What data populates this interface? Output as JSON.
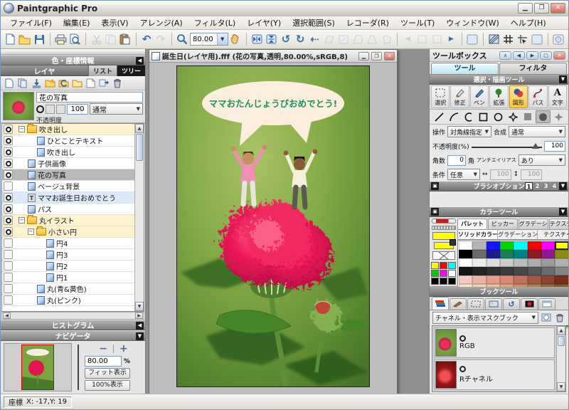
{
  "window": {
    "title": "Paintgraphic Pro"
  },
  "menu": {
    "items": [
      "ファイル(F)",
      "編集(E)",
      "表示(V)",
      "アレンジ(A)",
      "フィルタ(L)",
      "レイヤ(Y)",
      "選択範囲(S)",
      "レコーダ(R)",
      "ツール(T)",
      "ウィンドウ(W)",
      "ヘルプ(H)"
    ]
  },
  "toolbar": {
    "zoom_value": "80.00"
  },
  "left_panel": {
    "color_info_header": "色・座標情報",
    "layers": {
      "header": "レイヤ",
      "tab_list": "リスト",
      "tab_tree": "ツリー",
      "active_name": "花の写真",
      "opacity_value": "100",
      "blend_mode": "通常",
      "opacity_label": "不透明度(%)",
      "items": [
        {
          "label": "吹き出し",
          "type": "folder",
          "indent": 0,
          "visible": true,
          "selected": false,
          "hl": false
        },
        {
          "label": "ひとことテキスト",
          "type": "layer",
          "indent": 2,
          "visible": true,
          "selected": false,
          "hl": false
        },
        {
          "label": "吹き出し",
          "type": "layer",
          "indent": 2,
          "visible": true,
          "selected": false,
          "hl": false
        },
        {
          "label": "子供画像",
          "type": "layer",
          "indent": 1,
          "visible": true,
          "selected": false,
          "hl": false
        },
        {
          "label": "花の写真",
          "type": "layer",
          "indent": 1,
          "visible": true,
          "selected": true,
          "hl": false
        },
        {
          "label": "ベージュ背景",
          "type": "layer",
          "indent": 1,
          "visible": false,
          "selected": false,
          "hl": false
        },
        {
          "label": "ママお誕生日おめでとう",
          "type": "text",
          "indent": 1,
          "visible": true,
          "selected": false,
          "hl": true
        },
        {
          "label": "パス",
          "type": "layer",
          "indent": 1,
          "visible": true,
          "selected": false,
          "hl": false
        },
        {
          "label": "丸イラスト",
          "type": "folder",
          "indent": 0,
          "visible": true,
          "selected": false,
          "hl": false
        },
        {
          "label": "小さい円",
          "type": "folder",
          "indent": 1,
          "visible": true,
          "selected": false,
          "hl": false
        },
        {
          "label": "円4",
          "type": "layer",
          "indent": 3,
          "visible": false,
          "selected": false,
          "hl": false
        },
        {
          "label": "円3",
          "type": "layer",
          "indent": 3,
          "visible": false,
          "selected": false,
          "hl": false
        },
        {
          "label": "円2",
          "type": "layer",
          "indent": 3,
          "visible": false,
          "selected": false,
          "hl": false
        },
        {
          "label": "円1",
          "type": "layer",
          "indent": 3,
          "visible": false,
          "selected": false,
          "hl": false
        },
        {
          "label": "丸(青&黄色)",
          "type": "layer",
          "indent": 2,
          "visible": false,
          "selected": false,
          "hl": false
        },
        {
          "label": "丸(ピンク)",
          "type": "layer",
          "indent": 2,
          "visible": false,
          "selected": false,
          "hl": false
        }
      ]
    },
    "histogram_header": "ヒストグラム",
    "navigator": {
      "header": "ナビゲータ",
      "minus": "−",
      "plus": "+",
      "zoom": "80.00",
      "percent": "%",
      "fit_label": "フィット表示",
      "full_label": "100%表示"
    }
  },
  "canvas": {
    "title": "誕生日(レイヤ用).fff (花の写真,透明,80.00%,sRGB,8)",
    "bubble_text": "ママおたんじょうびおめでとう!"
  },
  "right_panel": {
    "toolbox_header": "ツールボックス",
    "tab_tool": "ツール",
    "tab_filter": "フィルタ",
    "select_draw_header": "選択・描画ツール",
    "tools": [
      {
        "label": "選択"
      },
      {
        "label": "修正"
      },
      {
        "label": "ペン"
      },
      {
        "label": "拡張"
      },
      {
        "label": "図形"
      },
      {
        "label": "パス"
      },
      {
        "label": "文字"
      }
    ],
    "options": {
      "operation_label": "操作",
      "operation_value": "対角線指定",
      "blend_label": "合成",
      "blend_value": "通常",
      "opacity_label": "不透明度(%)",
      "opacity_value": "100",
      "corners_label": "角数",
      "corners_value": "0",
      "corners_unit": "角",
      "antialias_label": "アンチエイリアス",
      "antialias_value": "あり",
      "condition_label": "条件",
      "condition_value": "任意",
      "width_value": "100",
      "height_value": "100"
    },
    "brush_options_header": "ブラシオプション",
    "brush_pages": [
      "1",
      "2",
      "3",
      "4"
    ],
    "color_tools": {
      "header": "カラーツール",
      "tabs": [
        "パレット",
        "ピッカー",
        "グラデーション",
        "テクスチャ"
      ],
      "subtabs": [
        "ソリッドカラー",
        "グラデーション",
        "テクスチャ"
      ],
      "foreground_color": "#ffff00",
      "background_color": "#ffff00",
      "mini_palette": [
        "#ffff00",
        "#ff0000",
        "#00ffff",
        "#00cc00",
        "#ff00ff",
        "#ffffff",
        "#000000",
        "#000000",
        "#000000"
      ],
      "palette": [
        [
          "#ffffff",
          "#b4b4b4",
          "#1414ff",
          "#00d400",
          "#00ffff",
          "#ff0000",
          "#ff00ff",
          "#ffff00"
        ],
        [
          "#000000",
          "#6c6c6c",
          "#1c1c90",
          "#1c7c54",
          "#008080",
          "#8c1c24",
          "#8c1c8c",
          "#8c8c14"
        ],
        [
          "#fcfcfc",
          "#ececec",
          "#dcdcdc",
          "#cccccc",
          "#bcbcbc",
          "#acacac",
          "#9c9c9c",
          "#b0b0b0"
        ],
        [
          "#141414",
          "#242424",
          "#303030",
          "#3c3c3c",
          "#484848",
          "#585858",
          "#6c6c6c",
          "#848484"
        ],
        [
          "#f4ccc4",
          "#ecb4a4",
          "#e49c8c",
          "#dc8874",
          "#c4705c",
          "#a45844",
          "#8c4434",
          "#7c2c1c"
        ],
        [
          "#f4e4cc",
          "#ecd4b4",
          "#e4c49c",
          "#d4ac84",
          "#bc946c",
          "#a48054",
          "#8c6c44",
          "#746034"
        ],
        [
          "#ecf0bc",
          "#e0e49c",
          "#d0d47c",
          "#bcc05c",
          "#a4a844",
          "#8c9034",
          "#747820",
          "#5c6014"
        ],
        [
          "#e4f0b4",
          "#d4e494",
          "#c0d474",
          "#a8c454",
          "#8cac3c",
          "#74942c",
          "#5c7c1c",
          "#446410"
        ],
        [
          "#e4f4dc",
          "#ccecc0",
          "#ace49c",
          "#8cd478",
          "#6cc458",
          "#4cac40",
          "#38942c",
          "#247c1c"
        ],
        [
          "#ecfce4",
          "#d4f4cc",
          "#b4eca8",
          "#8cdc7c",
          "#64cc54",
          "#3cb434",
          "#249c24",
          "#148414"
        ]
      ],
      "selected_swatch": "#ffff00"
    },
    "book_tools": {
      "header": "ブックツール",
      "dropdown_value": "チャネル・表示マスクブック",
      "items": [
        {
          "label": "RGB"
        },
        {
          "label": "Rチャネル"
        }
      ]
    }
  },
  "status_bar": {
    "coord_label": "座標",
    "coord_value": "X: -17,Y: 19"
  }
}
